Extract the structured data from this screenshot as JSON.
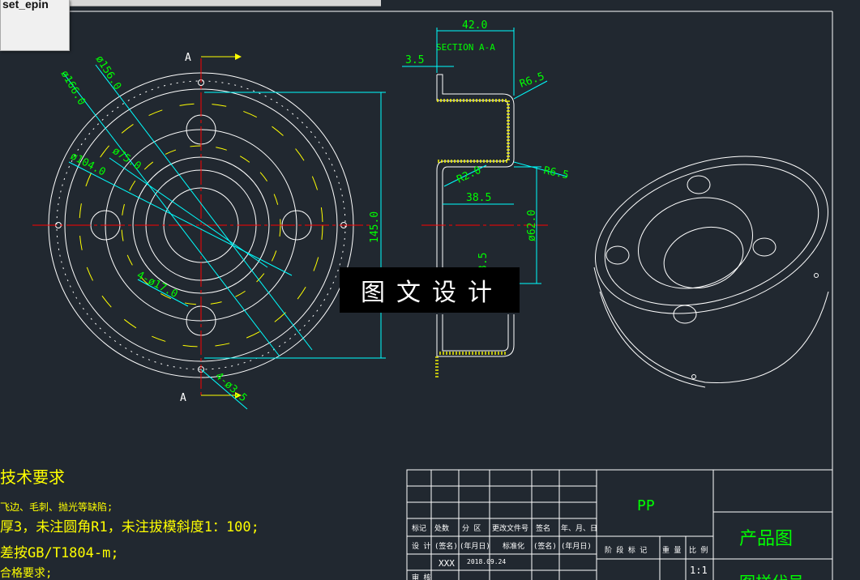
{
  "tab": {
    "label": "set_epin"
  },
  "drawing": {
    "section_label_top": "A",
    "section_label_bottom": "A",
    "section_title": "SECTION A-A",
    "dims": {
      "d166": "ø166.0",
      "d156": "ø156.0",
      "d104": "ø104.0",
      "d75": "ø75.0",
      "holes17": "4-ø17.0",
      "holes3_5": "4-ø3.5",
      "h145": "145.0",
      "w42": "42.0",
      "t3_5": "3.5",
      "r6_5_top": "R6.5",
      "r6_5_mid": "R6.5",
      "r2": "R2.0",
      "w38_5": "38.5",
      "d62": "ø62.0",
      "h3_5": "3.5"
    }
  },
  "watermark": {
    "text": "图文设计"
  },
  "tech": {
    "title": "技术要求",
    "line1": "飞边、毛刺、抛光等缺陷;",
    "line2": "厚3，未注圆角R1，未注拔模斜度1：100;",
    "line3": "差按GB/T1804-m;",
    "line4": "合格要求;"
  },
  "titleblock": {
    "material": "PP",
    "name": "产品图",
    "drawing_no": "图样代号",
    "scale": "1:1",
    "designer": "XXX",
    "date": "2018.09.24",
    "row_labels": [
      "标记",
      "处数",
      "分 区",
      "更改文件号",
      "签名",
      "年、月、日"
    ],
    "row_labels2": [
      "设 计",
      "(签名)",
      "(年月日)",
      "标准化",
      "(签名)",
      "(年月日)"
    ],
    "stage_labels": [
      "阶 段 标 记",
      "重 量",
      "比 例"
    ],
    "review": "审 核"
  },
  "colors": {
    "background": "#212830",
    "white": "#ffffff",
    "cyan": "#00ffff",
    "yellow": "#ffff00",
    "green": "#00ff00",
    "red": "#ff0000"
  }
}
